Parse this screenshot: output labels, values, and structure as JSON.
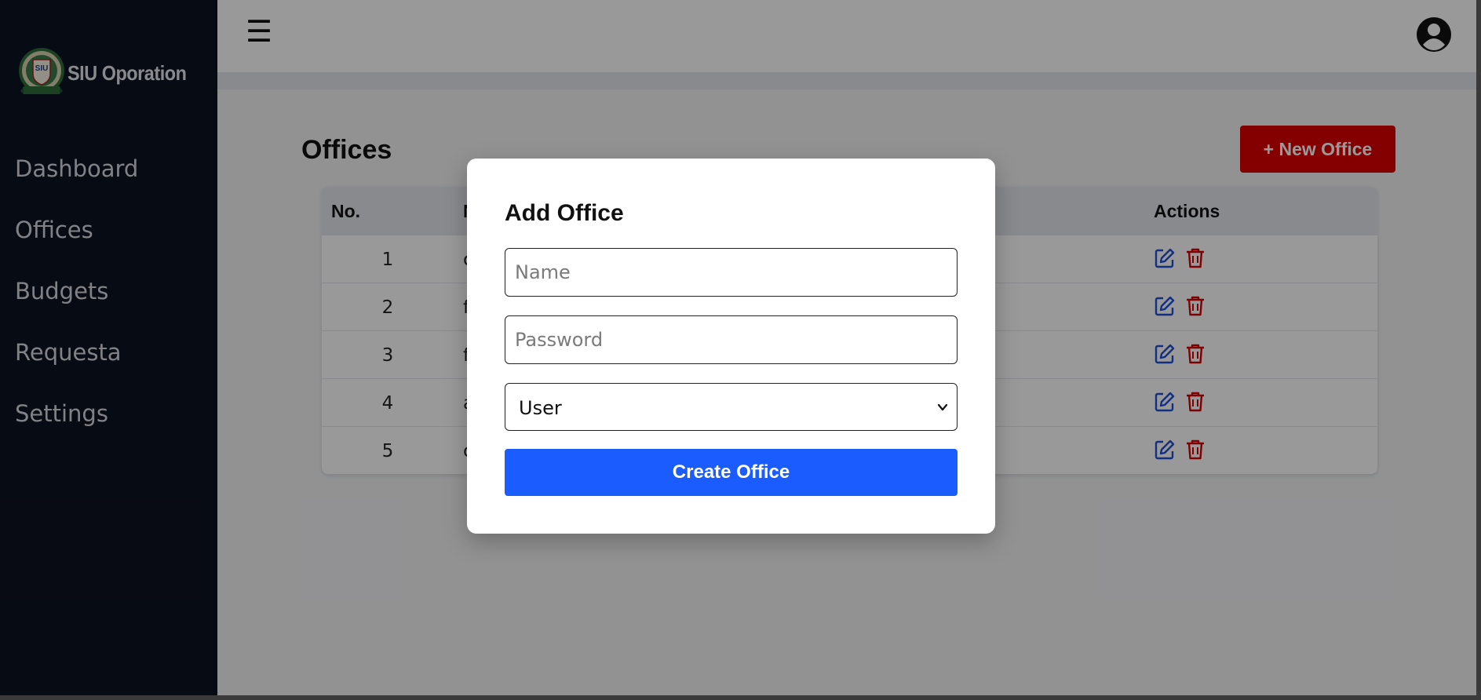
{
  "sidebar": {
    "brand_title": "SIU Oporation",
    "logo_text": "SIU",
    "items": [
      {
        "label": "Dashboard"
      },
      {
        "label": "Offices"
      },
      {
        "label": "Budgets"
      },
      {
        "label": "Requesta"
      },
      {
        "label": "Settings"
      }
    ],
    "bg_color": "#0d1321"
  },
  "header": {
    "menu_icon": "☰",
    "avatar_icon": "user-circle-icon"
  },
  "page": {
    "title": "Offices",
    "new_button_label": "+ New Office",
    "new_button_color": "#dc0000"
  },
  "table": {
    "headers": {
      "no": "No.",
      "name": "N",
      "actions": "Actions"
    },
    "rows": [
      {
        "no": "1",
        "name": "c"
      },
      {
        "no": "2",
        "name": "f"
      },
      {
        "no": "3",
        "name": "f"
      },
      {
        "no": "4",
        "name": "a"
      },
      {
        "no": "5",
        "name": "c"
      }
    ],
    "edit_icon_color": "#1e4fd8",
    "delete_icon_color": "#d40000"
  },
  "modal": {
    "title": "Add Office",
    "name_placeholder": "Name",
    "password_placeholder": "Password",
    "role_selected": "User",
    "submit_label": "Create Office",
    "submit_color": "#1a5cff"
  }
}
